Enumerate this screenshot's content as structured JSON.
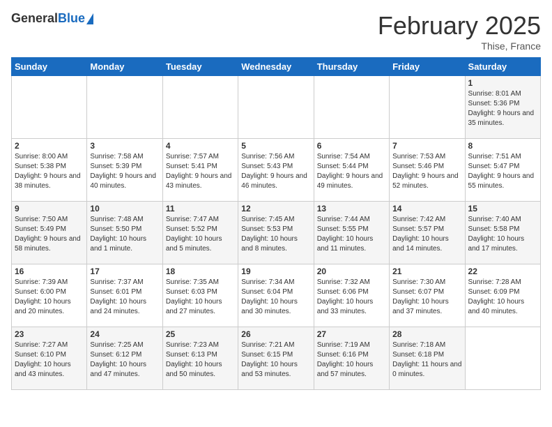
{
  "header": {
    "logo_general": "General",
    "logo_blue": "Blue",
    "title": "February 2025",
    "location": "Thise, France"
  },
  "days_of_week": [
    "Sunday",
    "Monday",
    "Tuesday",
    "Wednesday",
    "Thursday",
    "Friday",
    "Saturday"
  ],
  "weeks": [
    [
      {
        "day": null
      },
      {
        "day": null
      },
      {
        "day": null
      },
      {
        "day": null
      },
      {
        "day": null
      },
      {
        "day": null
      },
      {
        "day": "1",
        "sunrise": "Sunrise: 8:01 AM",
        "sunset": "Sunset: 5:36 PM",
        "daylight": "Daylight: 9 hours and 35 minutes."
      }
    ],
    [
      {
        "day": "2",
        "sunrise": "Sunrise: 8:00 AM",
        "sunset": "Sunset: 5:38 PM",
        "daylight": "Daylight: 9 hours and 38 minutes."
      },
      {
        "day": "3",
        "sunrise": "Sunrise: 7:58 AM",
        "sunset": "Sunset: 5:39 PM",
        "daylight": "Daylight: 9 hours and 40 minutes."
      },
      {
        "day": "4",
        "sunrise": "Sunrise: 7:57 AM",
        "sunset": "Sunset: 5:41 PM",
        "daylight": "Daylight: 9 hours and 43 minutes."
      },
      {
        "day": "5",
        "sunrise": "Sunrise: 7:56 AM",
        "sunset": "Sunset: 5:43 PM",
        "daylight": "Daylight: 9 hours and 46 minutes."
      },
      {
        "day": "6",
        "sunrise": "Sunrise: 7:54 AM",
        "sunset": "Sunset: 5:44 PM",
        "daylight": "Daylight: 9 hours and 49 minutes."
      },
      {
        "day": "7",
        "sunrise": "Sunrise: 7:53 AM",
        "sunset": "Sunset: 5:46 PM",
        "daylight": "Daylight: 9 hours and 52 minutes."
      },
      {
        "day": "8",
        "sunrise": "Sunrise: 7:51 AM",
        "sunset": "Sunset: 5:47 PM",
        "daylight": "Daylight: 9 hours and 55 minutes."
      }
    ],
    [
      {
        "day": "9",
        "sunrise": "Sunrise: 7:50 AM",
        "sunset": "Sunset: 5:49 PM",
        "daylight": "Daylight: 9 hours and 58 minutes."
      },
      {
        "day": "10",
        "sunrise": "Sunrise: 7:48 AM",
        "sunset": "Sunset: 5:50 PM",
        "daylight": "Daylight: 10 hours and 1 minute."
      },
      {
        "day": "11",
        "sunrise": "Sunrise: 7:47 AM",
        "sunset": "Sunset: 5:52 PM",
        "daylight": "Daylight: 10 hours and 5 minutes."
      },
      {
        "day": "12",
        "sunrise": "Sunrise: 7:45 AM",
        "sunset": "Sunset: 5:53 PM",
        "daylight": "Daylight: 10 hours and 8 minutes."
      },
      {
        "day": "13",
        "sunrise": "Sunrise: 7:44 AM",
        "sunset": "Sunset: 5:55 PM",
        "daylight": "Daylight: 10 hours and 11 minutes."
      },
      {
        "day": "14",
        "sunrise": "Sunrise: 7:42 AM",
        "sunset": "Sunset: 5:57 PM",
        "daylight": "Daylight: 10 hours and 14 minutes."
      },
      {
        "day": "15",
        "sunrise": "Sunrise: 7:40 AM",
        "sunset": "Sunset: 5:58 PM",
        "daylight": "Daylight: 10 hours and 17 minutes."
      }
    ],
    [
      {
        "day": "16",
        "sunrise": "Sunrise: 7:39 AM",
        "sunset": "Sunset: 6:00 PM",
        "daylight": "Daylight: 10 hours and 20 minutes."
      },
      {
        "day": "17",
        "sunrise": "Sunrise: 7:37 AM",
        "sunset": "Sunset: 6:01 PM",
        "daylight": "Daylight: 10 hours and 24 minutes."
      },
      {
        "day": "18",
        "sunrise": "Sunrise: 7:35 AM",
        "sunset": "Sunset: 6:03 PM",
        "daylight": "Daylight: 10 hours and 27 minutes."
      },
      {
        "day": "19",
        "sunrise": "Sunrise: 7:34 AM",
        "sunset": "Sunset: 6:04 PM",
        "daylight": "Daylight: 10 hours and 30 minutes."
      },
      {
        "day": "20",
        "sunrise": "Sunrise: 7:32 AM",
        "sunset": "Sunset: 6:06 PM",
        "daylight": "Daylight: 10 hours and 33 minutes."
      },
      {
        "day": "21",
        "sunrise": "Sunrise: 7:30 AM",
        "sunset": "Sunset: 6:07 PM",
        "daylight": "Daylight: 10 hours and 37 minutes."
      },
      {
        "day": "22",
        "sunrise": "Sunrise: 7:28 AM",
        "sunset": "Sunset: 6:09 PM",
        "daylight": "Daylight: 10 hours and 40 minutes."
      }
    ],
    [
      {
        "day": "23",
        "sunrise": "Sunrise: 7:27 AM",
        "sunset": "Sunset: 6:10 PM",
        "daylight": "Daylight: 10 hours and 43 minutes."
      },
      {
        "day": "24",
        "sunrise": "Sunrise: 7:25 AM",
        "sunset": "Sunset: 6:12 PM",
        "daylight": "Daylight: 10 hours and 47 minutes."
      },
      {
        "day": "25",
        "sunrise": "Sunrise: 7:23 AM",
        "sunset": "Sunset: 6:13 PM",
        "daylight": "Daylight: 10 hours and 50 minutes."
      },
      {
        "day": "26",
        "sunrise": "Sunrise: 7:21 AM",
        "sunset": "Sunset: 6:15 PM",
        "daylight": "Daylight: 10 hours and 53 minutes."
      },
      {
        "day": "27",
        "sunrise": "Sunrise: 7:19 AM",
        "sunset": "Sunset: 6:16 PM",
        "daylight": "Daylight: 10 hours and 57 minutes."
      },
      {
        "day": "28",
        "sunrise": "Sunrise: 7:18 AM",
        "sunset": "Sunset: 6:18 PM",
        "daylight": "Daylight: 11 hours and 0 minutes."
      },
      {
        "day": null
      }
    ]
  ]
}
